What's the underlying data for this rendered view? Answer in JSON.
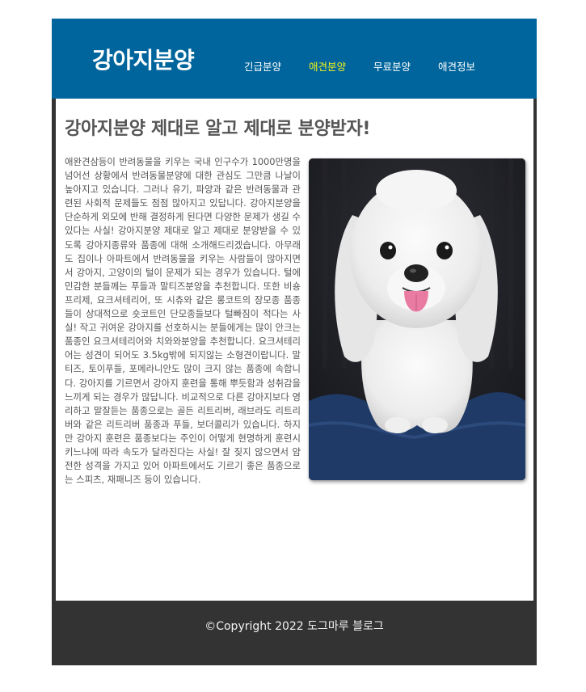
{
  "header": {
    "logo": "강아지분양",
    "nav": [
      {
        "label": "긴급분양",
        "active": false
      },
      {
        "label": "애견분양",
        "active": true
      },
      {
        "label": "무료분양",
        "active": false
      },
      {
        "label": "애견정보",
        "active": false
      }
    ]
  },
  "main": {
    "headline": "강아지분양 제대로 알고 제대로 분양받자!",
    "article": "애완견삼등이 반려동물을 키우는 국내 인구수가 1000만명을 넘어선 상황에서 반려동물분양에 대한 관심도 그만큼 나날이 높아지고 있습니다. 그러나 유기, 파양과 같은 반려동물과 관련된 사회적 문제들도 점점 많아지고 있답니다. 강아지분양을 단순하게 외모에 반해 결정하게 된다면 다양한 문제가 생길 수 있다는 사실! 강아지분양 제대로 알고 제대로 분양받을 수 있도록 강아지종류와 품종에 대해 소개해드리겠습니다. 아무래도 집이나 아파트에서 반려동물을 키우는 사람들이 많아지면서 강아지, 고양이의 털이 문제가 되는 경우가 있습니다. 털에 민감한 분들께는 푸들과 말티즈분양을 추천합니다. 또한 비숑프리제, 요크셔테리어, 또 시츄와 같은 롱코트의 장모종 품종들이 상대적으로 숏코트인 단모종들보다 털빠짐이 적다는 사실! 작고 귀여운 강아지를 선호하시는 분들에게는 많이 안크는 품종인 요크셔테리어와 치와와분양을 추천합니다. 요크셔테리어는 성견이 되어도 3.5kg밖에 되지않는 소형견이랍니다. 말티즈, 토이푸들, 포메라니안도 많이 크지 않는 품종에 속합니다. 강아지를 기르면서 강아지 훈련을 통해 뿌듯함과 성취감을 느끼게 되는 경우가 많답니다. 비교적으로 다른 강아지보다 영리하고 말잘듣는 품종으로는 골든 리트리버, 래브라도 리트리버와 같은 리트리버 품종과 푸들, 보더콜리가 있습니다. 하지만 강아지 훈련은 품종보다는 주인이 어떻게 현명하게 훈련시키느냐에 따라 속도가 달라진다는 사실! 잘 짖지 않으면서 얌전한 성격을 가지고 있어 아파트에서도 기르기 좋은 품종으로는 스피츠, 재패니즈 등이 있습니다.",
    "photo_subject": "white-maltese-puppy"
  },
  "footer": {
    "copyright": "©Copyright 2022 도그마루 블로그"
  },
  "colors": {
    "header_bg": "#00659c",
    "page_frame": "#333333",
    "nav_active": "#f1f21a",
    "body_text": "#555555"
  }
}
